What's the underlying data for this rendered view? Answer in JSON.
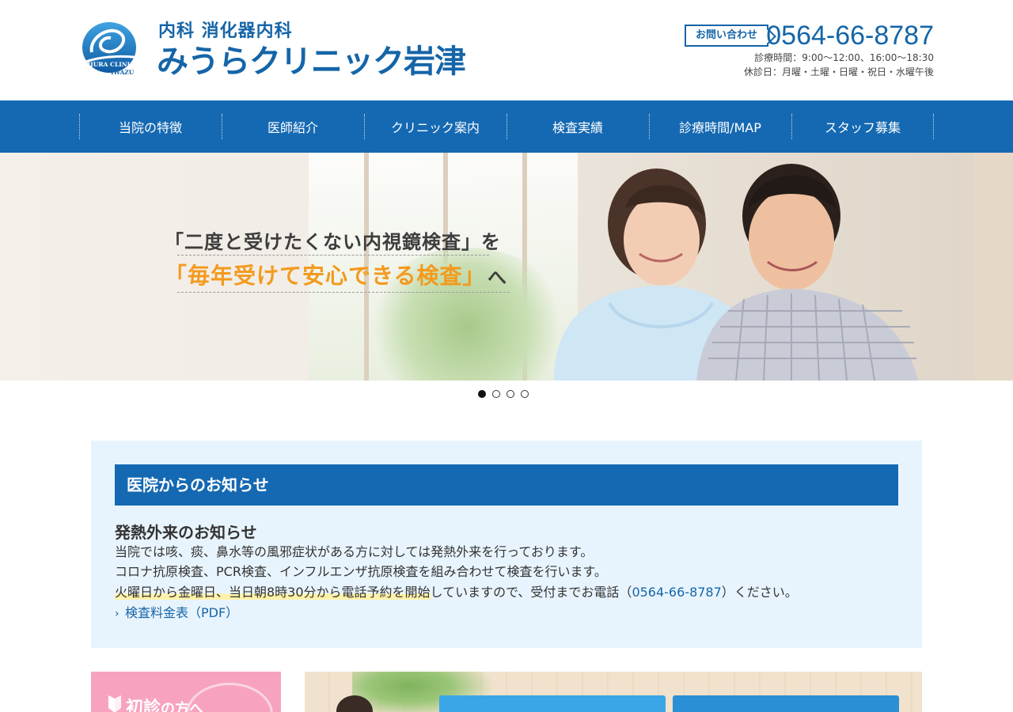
{
  "header": {
    "logo_sub": "内科  消化器内科",
    "logo_name": "みうらクリニック岩津",
    "logo_mark_text": [
      "MIURA CLINIC",
      "IWAZU"
    ],
    "contact_badge": "お問い合わせ",
    "phone": "0564-66-8787",
    "hours": "診療時間：9:00～12:00、16:00～18:30",
    "closed": "休診日：月曜・土曜・日曜・祝日・水曜午後"
  },
  "nav": {
    "items": [
      "当院の特徴",
      "医師紹介",
      "クリニック案内",
      "検査実績",
      "診療時間/MAP",
      "スタッフ募集"
    ]
  },
  "hero": {
    "line1": "「二度と受けたくない内視鏡検査」を",
    "line2": "「毎年受けて安心できる検査」",
    "line2_tail": "へ",
    "slide_count": 4,
    "active_slide": 1
  },
  "notice": {
    "title": "医院からのお知らせ",
    "heading": "発熱外来のお知らせ",
    "p1": "当院では咳、痰、鼻水等の風邪症状がある方に対しては発熱外来を行っております。",
    "p2": "コロナ抗原検査、PCR検査、インフルエンザ抗原検査を組み合わせて検査を行います。",
    "p3_highlight": "火曜日から金曜日、当日朝8時30分から電話予約を開始",
    "p3_mid": "していますので、受付までお電話（",
    "p3_tel": "0564-66-8787",
    "p3_end": "）ください。",
    "pdf_link": "検査料金表（PDF）"
  },
  "banners": {
    "first_visit": "初診",
    "first_visit_tail": "の方へ"
  },
  "colors": {
    "brand": "#1569b2",
    "accent_orange": "#f39a1e",
    "notice_bg": "#e8f4fd",
    "pink": "#f7a3bf"
  }
}
